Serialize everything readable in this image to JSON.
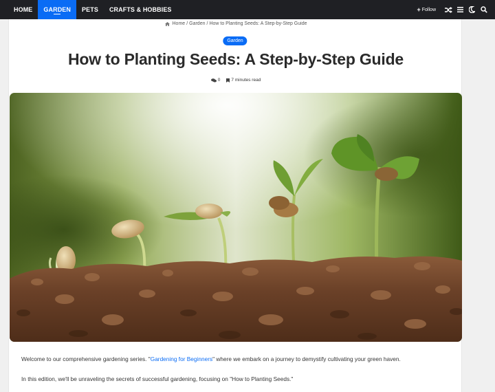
{
  "nav": {
    "items": [
      {
        "label": "HOME"
      },
      {
        "label": "GARDEN"
      },
      {
        "label": "PETS"
      },
      {
        "label": "CRAFTS & HOBBIES"
      }
    ],
    "follow_label": "Follow",
    "icons": [
      "shuffle-icon",
      "menu-icon",
      "moon-icon",
      "search-icon"
    ]
  },
  "breadcrumb": {
    "home": "Home",
    "sep1": "/",
    "category": "Garden",
    "sep2": "/",
    "current": "How to Planting Seeds: A Step-by-Step Guide"
  },
  "article": {
    "category_badge": "Garden",
    "title": "How to Planting Seeds: A Step-by-Step Guide",
    "comments_count": "0",
    "read_time": "7 minutes read",
    "p1_before": "Welcome to our comprehensive gardening series. \"",
    "p1_link": "Gardening for Beginners",
    "p1_after": "\" where we embark on a journey to demystify cultivating your green haven.",
    "p2": "In this edition, we'll be unraveling the secrets of successful gardening, focusing on \"How to Planting Seeds.\""
  },
  "colors": {
    "topbar": "#1f2024",
    "accent": "#0a6cf5",
    "title_text": "#2a2a2a"
  }
}
